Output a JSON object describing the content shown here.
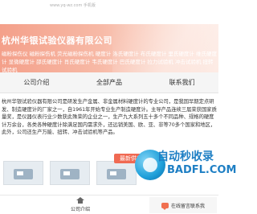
{
  "header": {
    "tiny_url": "www.yq-wz.com 手机版",
    "company_name": "杭州华银试验仪器有限公司",
    "keywords": "磁粉探伤仪 磁粉探伤机 荧光磁粉探伤机 硬度计 洛氏硬度计 布氏硬度计 里氏硬度计 维氏硬度计 显微硬度计 邵氏硬度计 肖氏硬度计 韦氏硬度计 巴氏硬度计 拉力试验机 冲击试验机 扭转试验机"
  },
  "nav": {
    "items": [
      {
        "label": "公司介绍"
      },
      {
        "label": "全部产品"
      },
      {
        "label": "联系我们"
      }
    ]
  },
  "intro": {
    "text": "杭州华银试验仪器有限公司是研发生产金属、非金属材料硬度计的专业公司，是我国早期定点研发、制造硬度计的厂家之一，自1961年开始专业生产制造硬度计。主导产品连续三届荣获国家质量奖，是仪器仪表行业少数获此殊荣的企业之一，生产九大系列五十多个不同品种、规格的硬度计万余台，各类各种硬度计除满足国内需求外，还远销美国、欧、亚、非等70多个国家和地区，此外，公司还生产万能、扭转、冲击试验机等产品。"
  },
  "products": {
    "badge": "最新供应"
  },
  "watermark": {
    "title": "自动秒收录",
    "subtitle": "BADFL.COM"
  },
  "footer": {
    "intro_label": "公司介绍",
    "ask_label": "在线留言联系我"
  }
}
